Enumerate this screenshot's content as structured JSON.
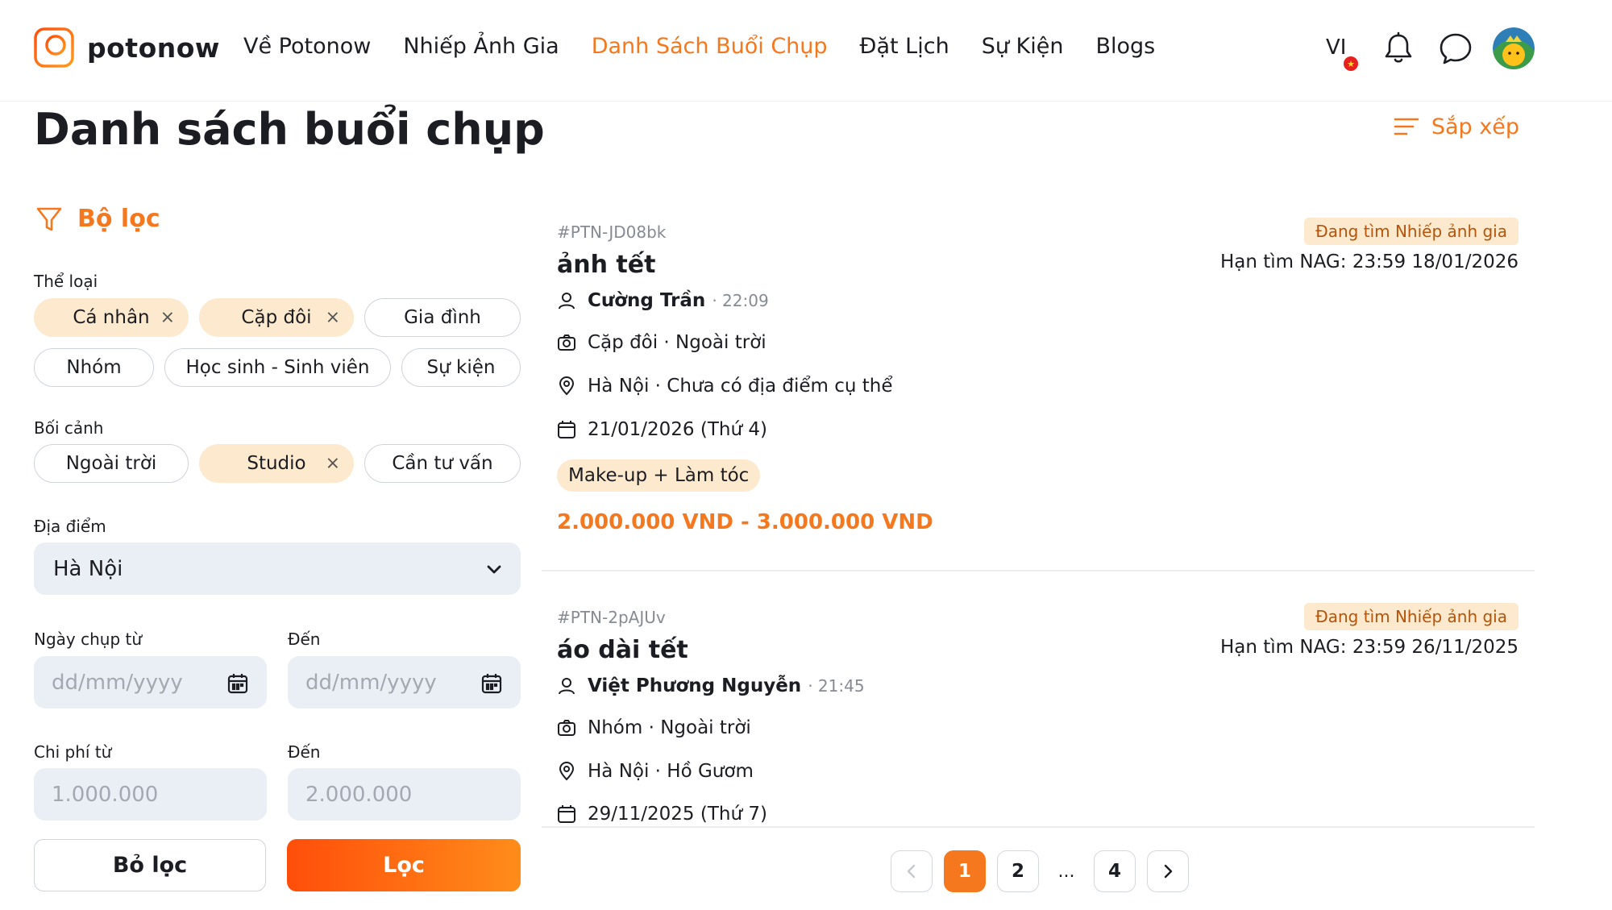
{
  "brand": {
    "name": "potonow",
    "accent": "#f5781f"
  },
  "nav": [
    {
      "label": "Về Potonow",
      "active": false
    },
    {
      "label": "Nhiếp Ảnh Gia",
      "active": false
    },
    {
      "label": "Danh Sách Buổi Chụp",
      "active": true
    },
    {
      "label": "Đặt Lịch",
      "active": false
    },
    {
      "label": "Sự Kiện",
      "active": false
    },
    {
      "label": "Blogs",
      "active": false
    }
  ],
  "header": {
    "language": "VI",
    "icons": [
      "bell-icon",
      "chat-icon",
      "avatar"
    ]
  },
  "page": {
    "title": "Danh sách buổi chụp",
    "sort_label": "Sắp xếp"
  },
  "filter": {
    "title": "Bộ lọc",
    "category_label": "Thể loại",
    "categories": [
      {
        "label": "Cá nhân",
        "selected": true
      },
      {
        "label": "Cặp đôi",
        "selected": true
      },
      {
        "label": "Gia đình",
        "selected": false
      },
      {
        "label": "Nhóm",
        "selected": false
      },
      {
        "label": "Học sinh - Sinh viên",
        "selected": false
      },
      {
        "label": "Sự kiện",
        "selected": false
      }
    ],
    "context_label": "Bối cảnh",
    "contexts": [
      {
        "label": "Ngoài trời",
        "selected": false
      },
      {
        "label": "Studio",
        "selected": true
      },
      {
        "label": "Cần tư vấn",
        "selected": false
      }
    ],
    "remove_glyph": "×",
    "location_label": "Địa điểm",
    "location_value": "Hà Nội",
    "date_from_label": "Ngày chụp từ",
    "date_to_label": "Đến",
    "date_placeholder": "dd/mm/yyyy",
    "cost_from_label": "Chi phí từ",
    "cost_to_label": "Đến",
    "cost_from_placeholder": "1.000.000",
    "cost_to_placeholder": "2.000.000",
    "reset_label": "Bỏ lọc",
    "apply_label": "Lọc"
  },
  "sessions": [
    {
      "code": "#PTN-JD08bk",
      "status": "Đang tìm Nhiếp ảnh gia",
      "deadline_label": "Hạn tìm NAG:",
      "deadline": "23:59 18/01/2026",
      "title": "ảnh tết",
      "author": "Cường Trần",
      "time": "· 22:09",
      "type": "Cặp đôi · Ngoài trời",
      "location": "Hà Nội · Chưa có địa điểm cụ thể",
      "date": "21/01/2026 (Thứ 4)",
      "tag": "Make-up + Làm tóc",
      "price": "2.000.000 VND - 3.000.000 VND"
    },
    {
      "code": "#PTN-2pAJUv",
      "status": "Đang tìm Nhiếp ảnh gia",
      "deadline_label": "Hạn tìm NAG:",
      "deadline": "23:59 26/11/2025",
      "title": "áo dài tết",
      "author": "Việt Phương Nguyễn",
      "time": "· 21:45",
      "type": "Nhóm · Ngoài trời",
      "location": "Hà Nội · Hồ Gươm",
      "date": "29/11/2025 (Thứ 7)"
    }
  ],
  "pagination": {
    "pages": [
      "1",
      "2",
      "4"
    ],
    "ellipsis": "...",
    "current": "1"
  }
}
